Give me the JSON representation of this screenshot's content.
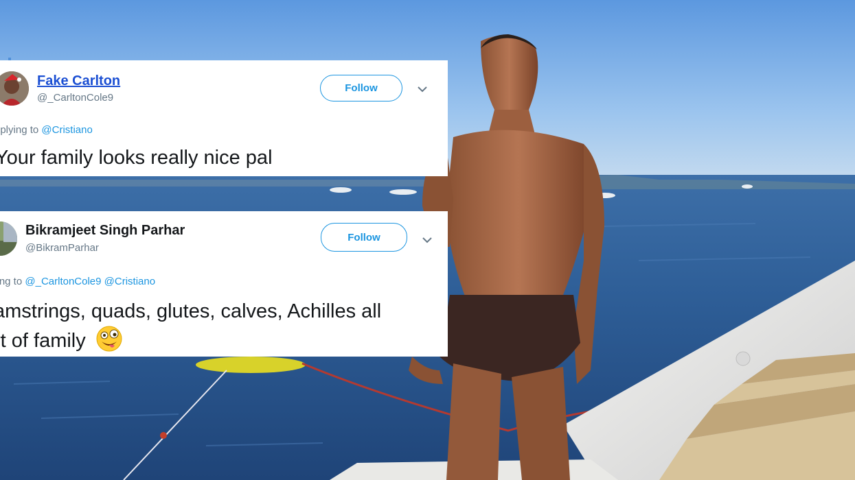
{
  "tweets": [
    {
      "display_name": "Fake Carlton",
      "handle": "@_CarltonCole9",
      "follow_label": "Follow",
      "reply_prefix": "eplying to",
      "reply_mentions": "@Cristiano",
      "text_line1": "Your family looks really nice pal"
    },
    {
      "display_name": "Bikramjeet Singh Parhar",
      "handle": "@BikramParhar",
      "follow_label": "Follow",
      "reply_prefix": "ying to",
      "reply_mentions": "@_CarltonCole9 @Cristiano",
      "text_line1": "amstrings, quads, glutes, calves, Achilles all",
      "text_line2": "rt of family"
    }
  ],
  "icons": {
    "chevron": "chevron-down-icon",
    "emoji": "zany-face-emoji"
  },
  "colors": {
    "link_blue": "#1b95e0",
    "name_link": "#1b4fd3",
    "secondary_text": "#657786",
    "sky": "#7fb2e6",
    "sea": "#2c5f9c"
  }
}
